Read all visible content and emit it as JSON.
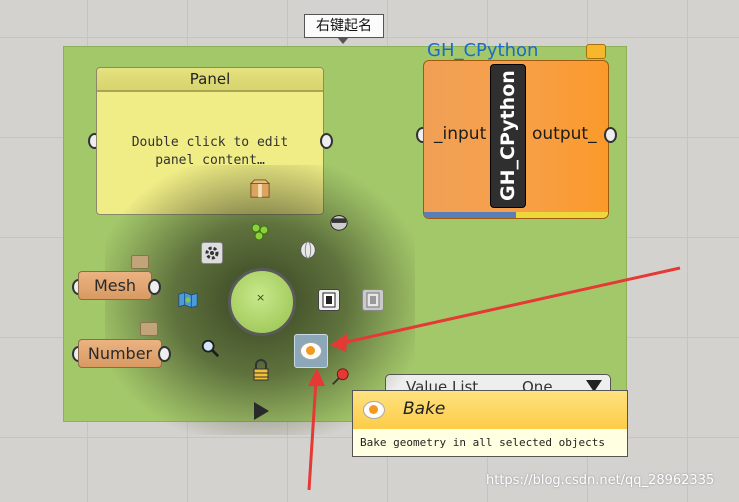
{
  "group": {
    "label": "右键起名"
  },
  "panel": {
    "title": "Panel",
    "content": "Double click to edit\npanel content…"
  },
  "python_component": {
    "title": "GH_CPython",
    "input": "_input",
    "output": "output_",
    "name": "GH_CPython"
  },
  "params": {
    "mesh": "Mesh",
    "number": "Number"
  },
  "value_list": {
    "label": "Value List",
    "value": "One"
  },
  "radial_menu": {
    "center_symbol": "×",
    "items": [
      "preferences-icon",
      "plugins-icon",
      "preview-mesh-icon",
      "preview-wire-icon",
      "enable-icon",
      "disable-icon",
      "map-icon",
      "zoom-icon",
      "lock-icon",
      "run-icon",
      "bake-icon",
      "pin-icon"
    ]
  },
  "tooltip": {
    "title": "Bake",
    "description": "Bake geometry in all selected objects"
  },
  "watermark": "https://blog.csdn.net/qq_28962335",
  "colors": {
    "group": "#a3c86a",
    "panel": "#f0ec86",
    "component": "#f7a04b",
    "arrow": "#e53935",
    "tooltip_head": "#fccc48"
  }
}
